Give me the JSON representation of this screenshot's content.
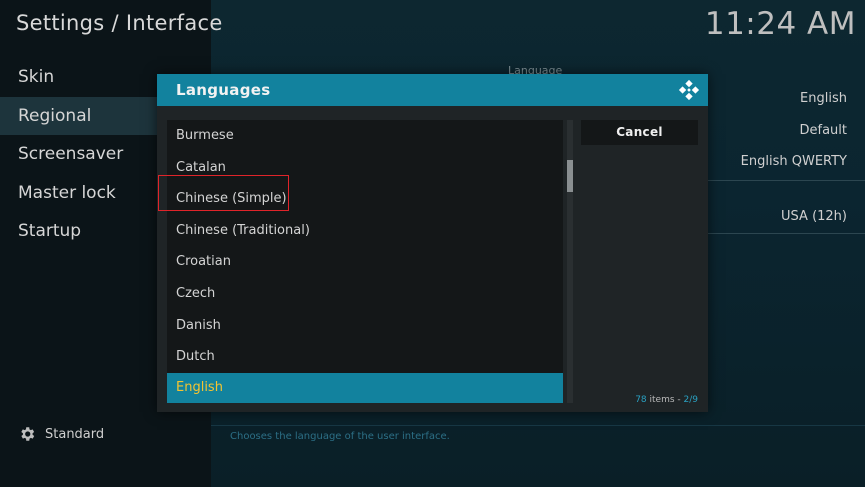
{
  "header": {
    "title": "Settings / Interface",
    "clock": "11:24 AM"
  },
  "sidebar": {
    "items": [
      {
        "label": "Skin"
      },
      {
        "label": "Regional"
      },
      {
        "label": "Screensaver"
      },
      {
        "label": "Master lock"
      },
      {
        "label": "Startup"
      }
    ],
    "active_index": 1,
    "footer_label": "Standard"
  },
  "settings": {
    "section_label": "Language",
    "rows": [
      {
        "value": "English"
      },
      {
        "value": "Default"
      },
      {
        "value": "English QWERTY"
      },
      {
        "value": "USA (12h)"
      }
    ],
    "help": "Chooses the language of the user interface."
  },
  "dialog": {
    "title": "Languages",
    "items": [
      {
        "label": "Burmese"
      },
      {
        "label": "Catalan"
      },
      {
        "label": "Chinese (Simple)"
      },
      {
        "label": "Chinese (Traditional)"
      },
      {
        "label": "Croatian"
      },
      {
        "label": "Czech"
      },
      {
        "label": "Danish"
      },
      {
        "label": "Dutch"
      },
      {
        "label": "English"
      }
    ],
    "selected_label": "English",
    "cancel_label": "Cancel",
    "count_total": "78",
    "count_items_text": " items - ",
    "count_page": "2/9"
  },
  "colors": {
    "accent": "#12829e",
    "selected_text": "#f4c431",
    "highlight_box": "#e0242a"
  },
  "icons": {
    "footer": "gear-icon",
    "dialog": "kodi-logo-icon"
  }
}
